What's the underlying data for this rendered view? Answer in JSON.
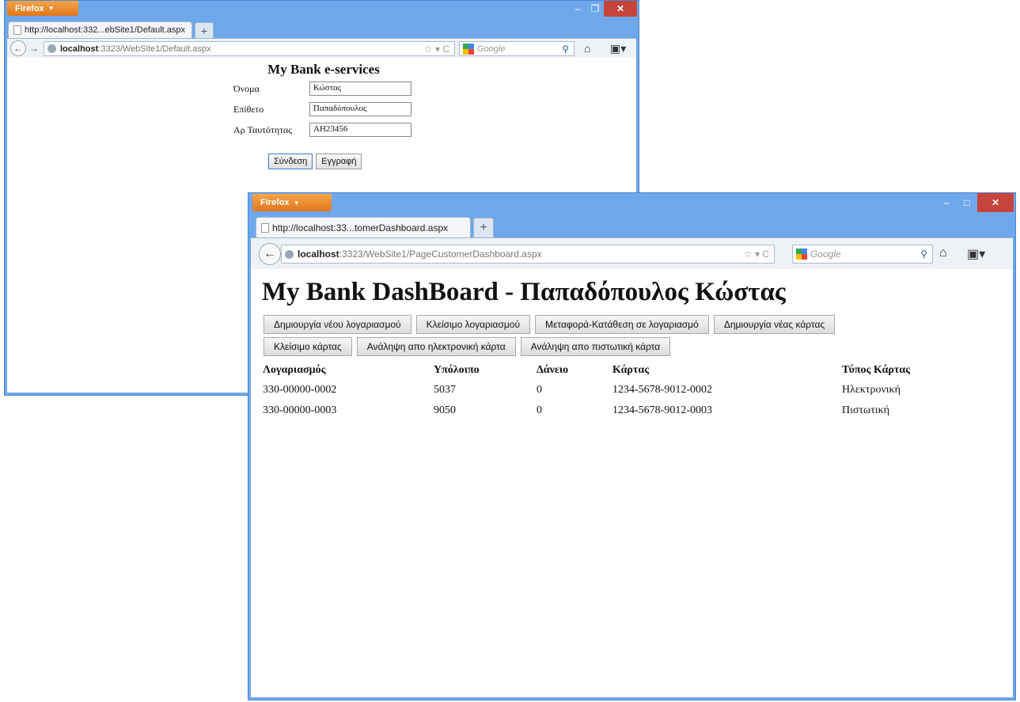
{
  "back_window": {
    "firefox_label": "Firefox",
    "tab_title": "http://localhost:332...ebSite1/Default.aspx",
    "url_host": "localhost",
    "url_rest": ":3323/WebSite1/Default.aspx",
    "search_placeholder": "Google",
    "login": {
      "title": "My Bank e-services",
      "fields": [
        {
          "label": "Όνομα",
          "value": "Κώστας"
        },
        {
          "label": "Επίθετο",
          "value": "Παπαδόπουλος"
        },
        {
          "label": "Αρ Ταυτότητας",
          "value": "AH23456"
        }
      ],
      "login_button": "Σύνδεση",
      "register_button": "Εγγραφή"
    }
  },
  "front_window": {
    "firefox_label": "Firefox",
    "tab_title": "http://localhost:33...tomerDashboard.aspx",
    "url_host": "localhost",
    "url_rest": ":3323/WebSite1/PageCustomerDashboard.aspx",
    "search_placeholder": "Google",
    "dashboard": {
      "title": "My Bank DashBoard - Παπαδόπουλος Κώστας",
      "buttons_row1": [
        "Δημιουργία νέου λογαριασμού",
        "Κλείσιμο λογαριασμού",
        "Μεταφορά-Κατάθεση σε λογαριασμό",
        "Δημιουργία νέας κάρτας"
      ],
      "buttons_row2": [
        "Κλείσιμο κάρτας",
        "Ανάληψη απο ηλεκτρονική κάρτα",
        "Ανάληψη απο πιστωτική κάρτα"
      ],
      "table": {
        "headers": [
          "Λογαριασμός",
          "Υπόλοιπο",
          "Δάνειο",
          "Κάρτας",
          "Τύπος Κάρτας"
        ],
        "rows": [
          [
            "330-00000-0002",
            "5037",
            "0",
            "1234-5678-9012-0002",
            "Ηλεκτρονική"
          ],
          [
            "330-00000-0003",
            "9050",
            "0",
            "1234-5678-9012-0003",
            "Πιστωτική"
          ]
        ]
      }
    }
  },
  "colors": {
    "window_frame": "#6fa8ea",
    "firefox_button": "#e0761a",
    "close_button": "#c7443a"
  }
}
